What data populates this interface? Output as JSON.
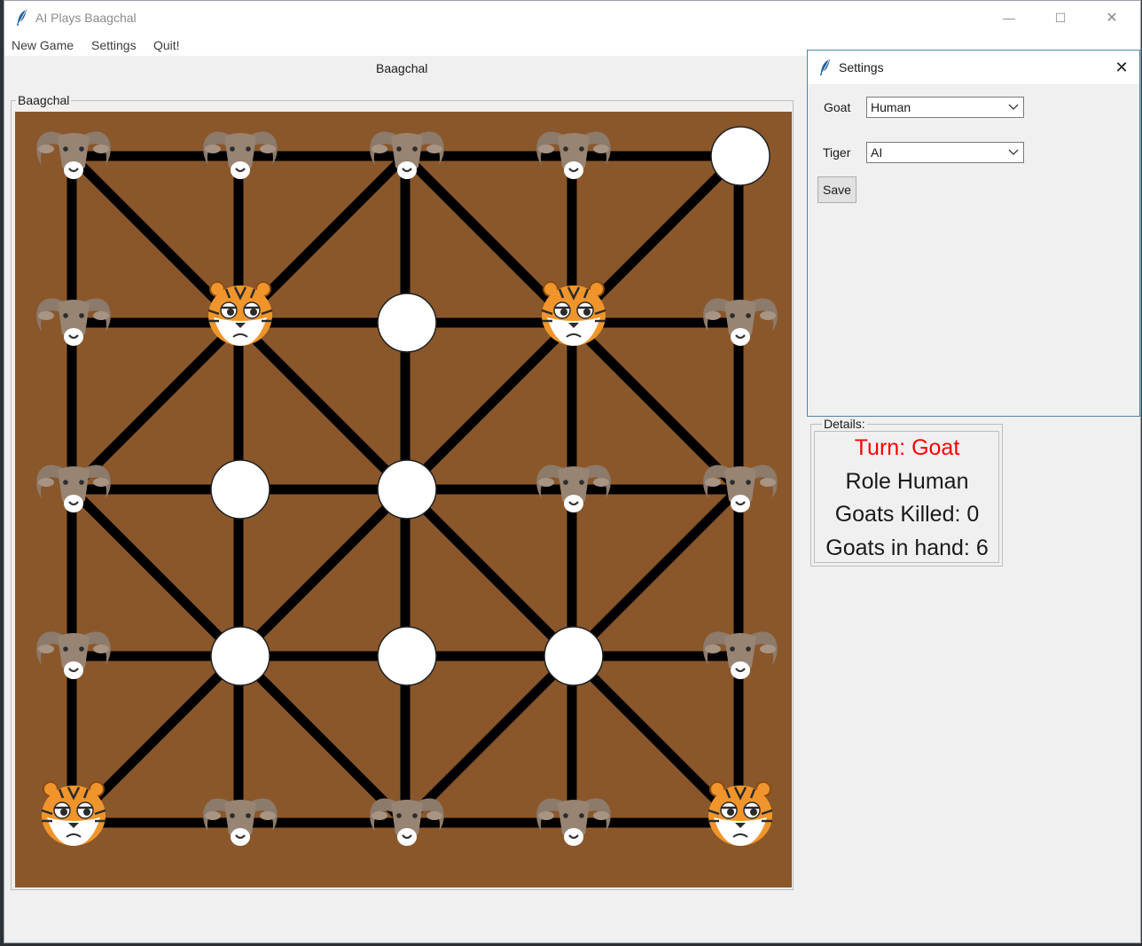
{
  "app": {
    "title": "AI Plays Baagchal"
  },
  "window_controls": {
    "minimize": "—",
    "maximize": "☐",
    "close": "✕"
  },
  "menu": {
    "items": [
      "New Game",
      "Settings",
      "Quit!"
    ]
  },
  "main": {
    "caption": "Baagchal",
    "frame_label": "Baagchal"
  },
  "board": {
    "rows": [
      [
        "goat",
        "goat",
        "goat",
        "goat",
        "empty"
      ],
      [
        "goat",
        "tiger",
        "empty",
        "tiger",
        "goat"
      ],
      [
        "goat",
        "empty",
        "empty",
        "goat",
        "goat"
      ],
      [
        "goat",
        "empty",
        "empty",
        "empty",
        "goat"
      ],
      [
        "tiger",
        "goat",
        "goat",
        "goat",
        "tiger"
      ]
    ]
  },
  "settings": {
    "title": "Settings",
    "close": "✕",
    "goat_label": "Goat",
    "goat_value": "Human",
    "tiger_label": "Tiger",
    "tiger_value": "AI",
    "save_label": "Save"
  },
  "details": {
    "legend": "Details:",
    "turn": "Turn: Goat",
    "role": "Role Human",
    "killed": "Goats Killed: 0",
    "in_hand": "Goats in hand: 6"
  },
  "colors": {
    "board": "#8a572b",
    "turn_text": "#ff0000",
    "text": "#1a1a1a",
    "empty_spot": "#ffffff",
    "tiger_orange": "#f0952b"
  },
  "icons": {
    "app": "feather-icon",
    "dropdown": "chevron-down-icon"
  }
}
